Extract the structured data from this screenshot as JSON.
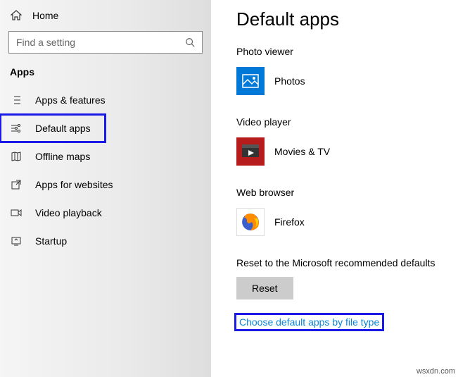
{
  "sidebar": {
    "home_label": "Home",
    "search_placeholder": "Find a setting",
    "section_title": "Apps",
    "items": [
      {
        "label": "Apps & features"
      },
      {
        "label": "Default apps"
      },
      {
        "label": "Offline maps"
      },
      {
        "label": "Apps for websites"
      },
      {
        "label": "Video playback"
      },
      {
        "label": "Startup"
      }
    ]
  },
  "main": {
    "title": "Default apps",
    "groups": {
      "photo": {
        "title": "Photo viewer",
        "app_label": "Photos",
        "tile_color": "#0078d7"
      },
      "video": {
        "title": "Video player",
        "app_label": "Movies & TV",
        "tile_color": "#b71c1c"
      },
      "web": {
        "title": "Web browser",
        "app_label": "Firefox",
        "tile_color": "#ffffff"
      }
    },
    "reset_text": "Reset to the Microsoft recommended defaults",
    "reset_button": "Reset",
    "file_type_link": "Choose default apps by file type"
  },
  "watermark": "wsxdn.com",
  "highlight_color": "#1a1ae6"
}
